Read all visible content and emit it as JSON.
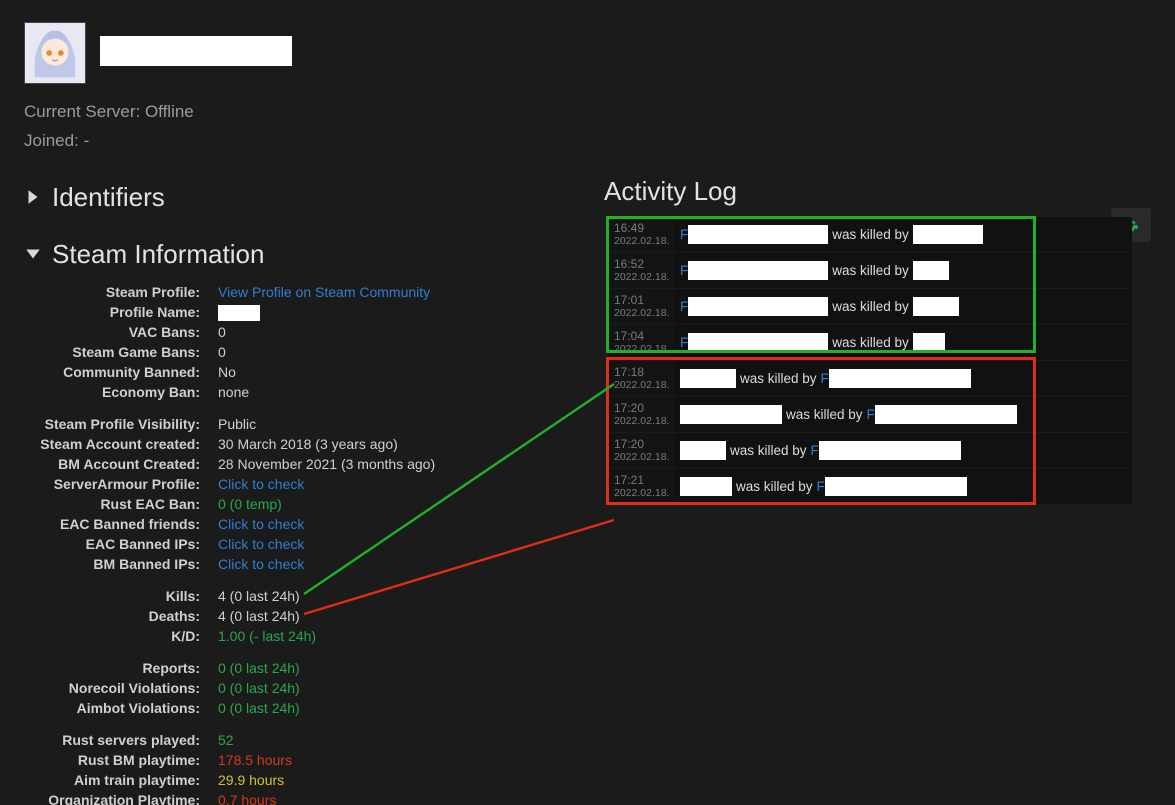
{
  "header": {
    "current_server_label": "Current Server:",
    "current_server_value": "Offline",
    "joined_label": "Joined:",
    "joined_value": "-"
  },
  "sections": {
    "identifiers_title": "Identifiers",
    "steam_info_title": "Steam Information",
    "activity_log_title": "Activity Log"
  },
  "info": [
    {
      "label": "Steam Profile:",
      "value": "View Profile on Steam Community",
      "cls": "link",
      "interact": true
    },
    {
      "label": "Profile Name:",
      "value": "",
      "whitebox": 42
    },
    {
      "label": "VAC Bans:",
      "value": "0"
    },
    {
      "label": "Steam Game Bans:",
      "value": "0"
    },
    {
      "label": "Community Banned:",
      "value": "No"
    },
    {
      "label": "Economy Ban:",
      "value": "none"
    },
    {
      "spacer": true
    },
    {
      "label": "Steam Profile Visibility:",
      "value": "Public"
    },
    {
      "label": "Steam Account created:",
      "value": "30 March 2018 (3 years ago)"
    },
    {
      "label": "BM Account Created:",
      "value": "28 November 2021 (3 months ago)"
    },
    {
      "label": "ServerArmour Profile:",
      "value": "Click to check",
      "cls": "link",
      "interact": true
    },
    {
      "label": "Rust EAC Ban:",
      "value": "0 (0 temp)",
      "cls": "green"
    },
    {
      "label": "EAC Banned friends:",
      "value": "Click to check",
      "cls": "link",
      "interact": true
    },
    {
      "label": "EAC Banned IPs:",
      "value": "Click to check",
      "cls": "link",
      "interact": true
    },
    {
      "label": "BM Banned IPs:",
      "value": "Click to check",
      "cls": "link",
      "interact": true
    },
    {
      "spacer": true
    },
    {
      "label": "Kills:",
      "value": "4 (0 last 24h)"
    },
    {
      "label": "Deaths:",
      "value": "4 (0 last 24h)"
    },
    {
      "label": "K/D:",
      "value": "1.00 (- last 24h)",
      "cls": "green"
    },
    {
      "spacer": true
    },
    {
      "label": "Reports:",
      "value": "0 (0 last 24h)",
      "cls": "green"
    },
    {
      "label": "Norecoil Violations:",
      "value": "0 (0 last 24h)",
      "cls": "green"
    },
    {
      "label": "Aimbot Violations:",
      "value": "0 (0 last 24h)",
      "cls": "green"
    },
    {
      "spacer": true
    },
    {
      "label": "Rust servers played:",
      "value": "52",
      "cls": "green"
    },
    {
      "label": "Rust BM playtime:",
      "value": "178.5 hours",
      "cls": "red"
    },
    {
      "label": "Aim train playtime:",
      "value": "29.9 hours",
      "cls": "yellow"
    },
    {
      "label": "Organization Playtime:",
      "value": "0.7 hours",
      "cls": "red"
    }
  ],
  "log": {
    "rows": [
      {
        "time": "16:49",
        "date": "2022.02.18.",
        "group": "g",
        "blue": "F",
        "pre_w": 140,
        "txt": "was killed by",
        "post_w": 70
      },
      {
        "time": "16:52",
        "date": "2022.02.18.",
        "group": "g",
        "blue": "F",
        "pre_w": 140,
        "txt": "was killed by",
        "post_w": 36
      },
      {
        "time": "17:01",
        "date": "2022.02.18.",
        "group": "g",
        "blue": "F",
        "pre_w": 140,
        "txt": "was killed by",
        "post_w": 46
      },
      {
        "time": "17:04",
        "date": "2022.02.18.",
        "group": "g",
        "blue": "F",
        "pre_w": 140,
        "txt": "was killed by",
        "post_w": 32
      },
      {
        "time": "17:18",
        "date": "2022.02.18.",
        "group": "r",
        "pre_w": 56,
        "txt": "was killed by",
        "blue_after": "F",
        "post_w": 142
      },
      {
        "time": "17:20",
        "date": "2022.02.18.",
        "group": "r",
        "pre_w": 102,
        "txt": "was killed by",
        "blue_after": "F",
        "post_w": 142
      },
      {
        "time": "17:20",
        "date": "2022.02.18.",
        "group": "r",
        "pre_w": 46,
        "txt": "was killed by",
        "blue_after": "F",
        "post_w": 142
      },
      {
        "time": "17:21",
        "date": "2022.02.18.",
        "group": "r",
        "pre_w": 52,
        "txt": "was killed by",
        "blue_after": "F",
        "post_w": 142
      }
    ],
    "footer_date": ""
  }
}
